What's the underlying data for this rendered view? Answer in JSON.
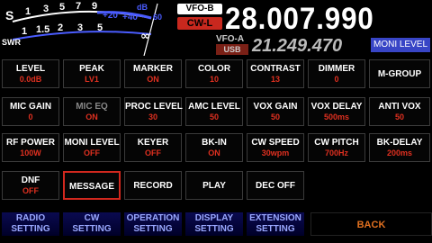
{
  "meter": {
    "s_scale": [
      "S",
      "1",
      "3",
      "5",
      "7",
      "9",
      "+20",
      "+40",
      "dB",
      "60"
    ],
    "swr_label": "SWR",
    "swr_scale": [
      "1",
      "1.5",
      "2",
      "3",
      "5",
      "∞"
    ],
    "colors": {
      "s_scale": "#ffffff",
      "plus_scale": "#4a5cff",
      "needle": "#ffffff"
    }
  },
  "vfo_b": {
    "label": "VFO-B",
    "mode": "CW-L",
    "frequency": "28.007.990"
  },
  "vfo_a": {
    "label": "VFO-A",
    "mode": "USB",
    "frequency": "21.249.470"
  },
  "moni_level_badge": "MONI LEVEL",
  "rows": [
    [
      {
        "label": "LEVEL",
        "value": "0.0dB"
      },
      {
        "label": "PEAK",
        "value": "LV1"
      },
      {
        "label": "MARKER",
        "value": "ON"
      },
      {
        "label": "COLOR",
        "value": "10"
      },
      {
        "label": "CONTRAST",
        "value": "13"
      },
      {
        "label": "DIMMER",
        "value": "0"
      },
      {
        "label": "M-GROUP",
        "value": ""
      }
    ],
    [
      {
        "label": "MIC GAIN",
        "value": "0"
      },
      {
        "label": "MIC EQ",
        "value": "ON"
      },
      {
        "label": "PROC LEVEL",
        "value": "30"
      },
      {
        "label": "AMC LEVEL",
        "value": "50"
      },
      {
        "label": "VOX GAIN",
        "value": "50"
      },
      {
        "label": "VOX DELAY",
        "value": "500ms"
      },
      {
        "label": "ANTI VOX",
        "value": "50"
      }
    ],
    [
      {
        "label": "RF POWER",
        "value": "100W"
      },
      {
        "label": "MONI LEVEL",
        "value": "OFF"
      },
      {
        "label": "KEYER",
        "value": "OFF"
      },
      {
        "label": "BK-IN",
        "value": "ON"
      },
      {
        "label": "CW SPEED",
        "value": "30wpm"
      },
      {
        "label": "CW PITCH",
        "value": "700Hz"
      },
      {
        "label": "BK-DELAY",
        "value": "200ms"
      }
    ],
    [
      {
        "label": "DNF",
        "value": "OFF"
      },
      {
        "label": "MESSAGE",
        "value": ""
      },
      {
        "label": "RECORD",
        "value": ""
      },
      {
        "label": "PLAY",
        "value": ""
      },
      {
        "label": "DEC OFF",
        "value": ""
      }
    ]
  ],
  "settings": [
    {
      "line1": "RADIO",
      "line2": "SETTING"
    },
    {
      "line1": "CW",
      "line2": "SETTING"
    },
    {
      "line1": "OPERATION",
      "line2": "SETTING"
    },
    {
      "line1": "DISPLAY",
      "line2": "SETTING"
    },
    {
      "line1": "EXTENSION",
      "line2": "SETTING"
    }
  ],
  "back_label": "BACK",
  "accent_colors": {
    "value_red": "#e03020",
    "selected_border": "#d2281e",
    "setting_text": "#9aa8ff",
    "back_text": "#e07020"
  }
}
